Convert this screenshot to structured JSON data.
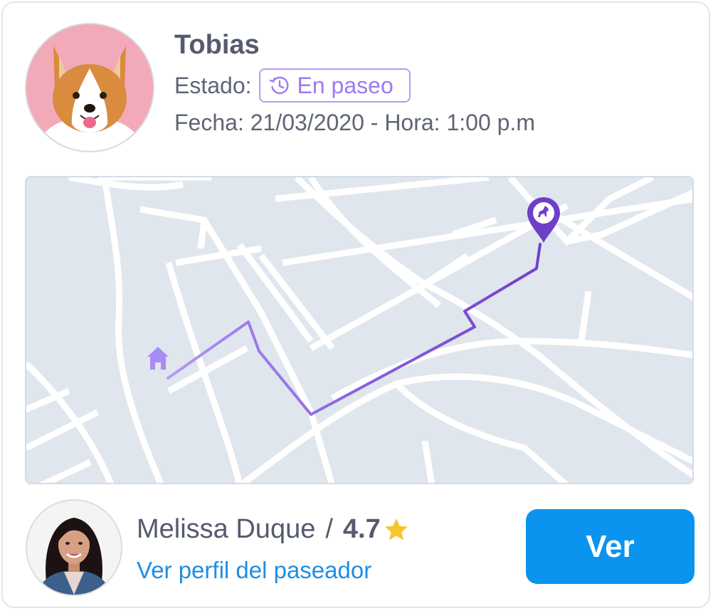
{
  "pet": {
    "name": "Tobias",
    "status_label": "Estado:",
    "status_value": "En paseo",
    "datetime": "Fecha: 21/03/2020 - Hora: 1:00 p.m"
  },
  "map": {
    "icons": [
      "home-icon",
      "dog-location-pin-icon"
    ],
    "route_color": "#7e57d8",
    "route_start_color": "#ad95f5"
  },
  "walker": {
    "name": "Melissa Duque",
    "separator": "/",
    "rating": "4.7",
    "profile_link": "Ver perfil del paseador",
    "star_icon": "star-icon"
  },
  "actions": {
    "view_label": "Ver"
  },
  "colors": {
    "accent_purple": "#9d7af2",
    "link_blue": "#1d8fe3",
    "button_blue": "#0a94ef",
    "star_yellow": "#f7c52e"
  }
}
